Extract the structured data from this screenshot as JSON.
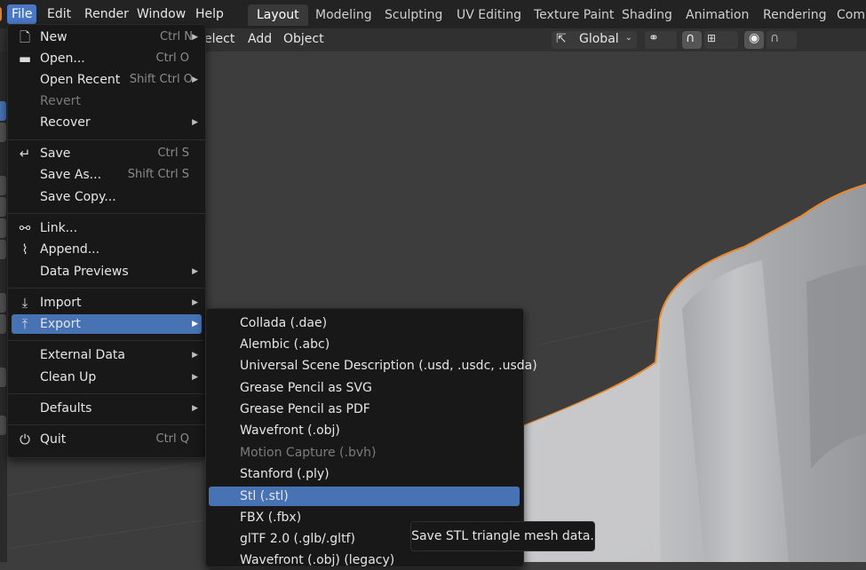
{
  "menubar": {
    "items": [
      "File",
      "Edit",
      "Render",
      "Window",
      "Help"
    ],
    "active": "File"
  },
  "workspaces": {
    "tabs": [
      "Layout",
      "Modeling",
      "Sculpting",
      "UV Editing",
      "Texture Paint",
      "Shading",
      "Animation",
      "Rendering",
      "Comp"
    ],
    "active": "Layout"
  },
  "viewport_header": {
    "select_partial": "elect",
    "add": "Add",
    "object": "Object",
    "orientation": "Global"
  },
  "file_menu": {
    "new": {
      "label": "New",
      "shortcut": "Ctrl N"
    },
    "open": {
      "label": "Open...",
      "shortcut": "Ctrl O"
    },
    "open_recent": {
      "label": "Open Recent",
      "shortcut": "Shift Ctrl O"
    },
    "revert": {
      "label": "Revert"
    },
    "recover": {
      "label": "Recover"
    },
    "save": {
      "label": "Save",
      "shortcut": "Ctrl S"
    },
    "save_as": {
      "label": "Save As...",
      "shortcut": "Shift Ctrl S"
    },
    "save_copy": {
      "label": "Save Copy..."
    },
    "link": {
      "label": "Link..."
    },
    "append": {
      "label": "Append..."
    },
    "data_previews": {
      "label": "Data Previews"
    },
    "import": {
      "label": "Import"
    },
    "export": {
      "label": "Export"
    },
    "external_data": {
      "label": "External Data"
    },
    "clean_up": {
      "label": "Clean Up"
    },
    "defaults": {
      "label": "Defaults"
    },
    "quit": {
      "label": "Quit",
      "shortcut": "Ctrl Q"
    }
  },
  "export_menu": [
    {
      "label": "Collada (.dae)"
    },
    {
      "label": "Alembic (.abc)"
    },
    {
      "label": "Universal Scene Description (.usd, .usdc, .usda)"
    },
    {
      "label": "Grease Pencil as SVG"
    },
    {
      "label": "Grease Pencil as PDF"
    },
    {
      "label": "Wavefront (.obj)"
    },
    {
      "label": "Motion Capture (.bvh)"
    },
    {
      "label": "Stanford (.ply)"
    },
    {
      "label": "Stl (.stl)"
    },
    {
      "label": "FBX (.fbx)"
    },
    {
      "label": "glTF 2.0 (.glb/.gltf)"
    },
    {
      "label": "Wavefront (.obj) (legacy)"
    }
  ],
  "tooltip": {
    "text": "Save STL triangle mesh data."
  },
  "colors": {
    "accent": "#4772b3",
    "selection_outline": "#e8892e",
    "menu_bg": "#181818"
  }
}
